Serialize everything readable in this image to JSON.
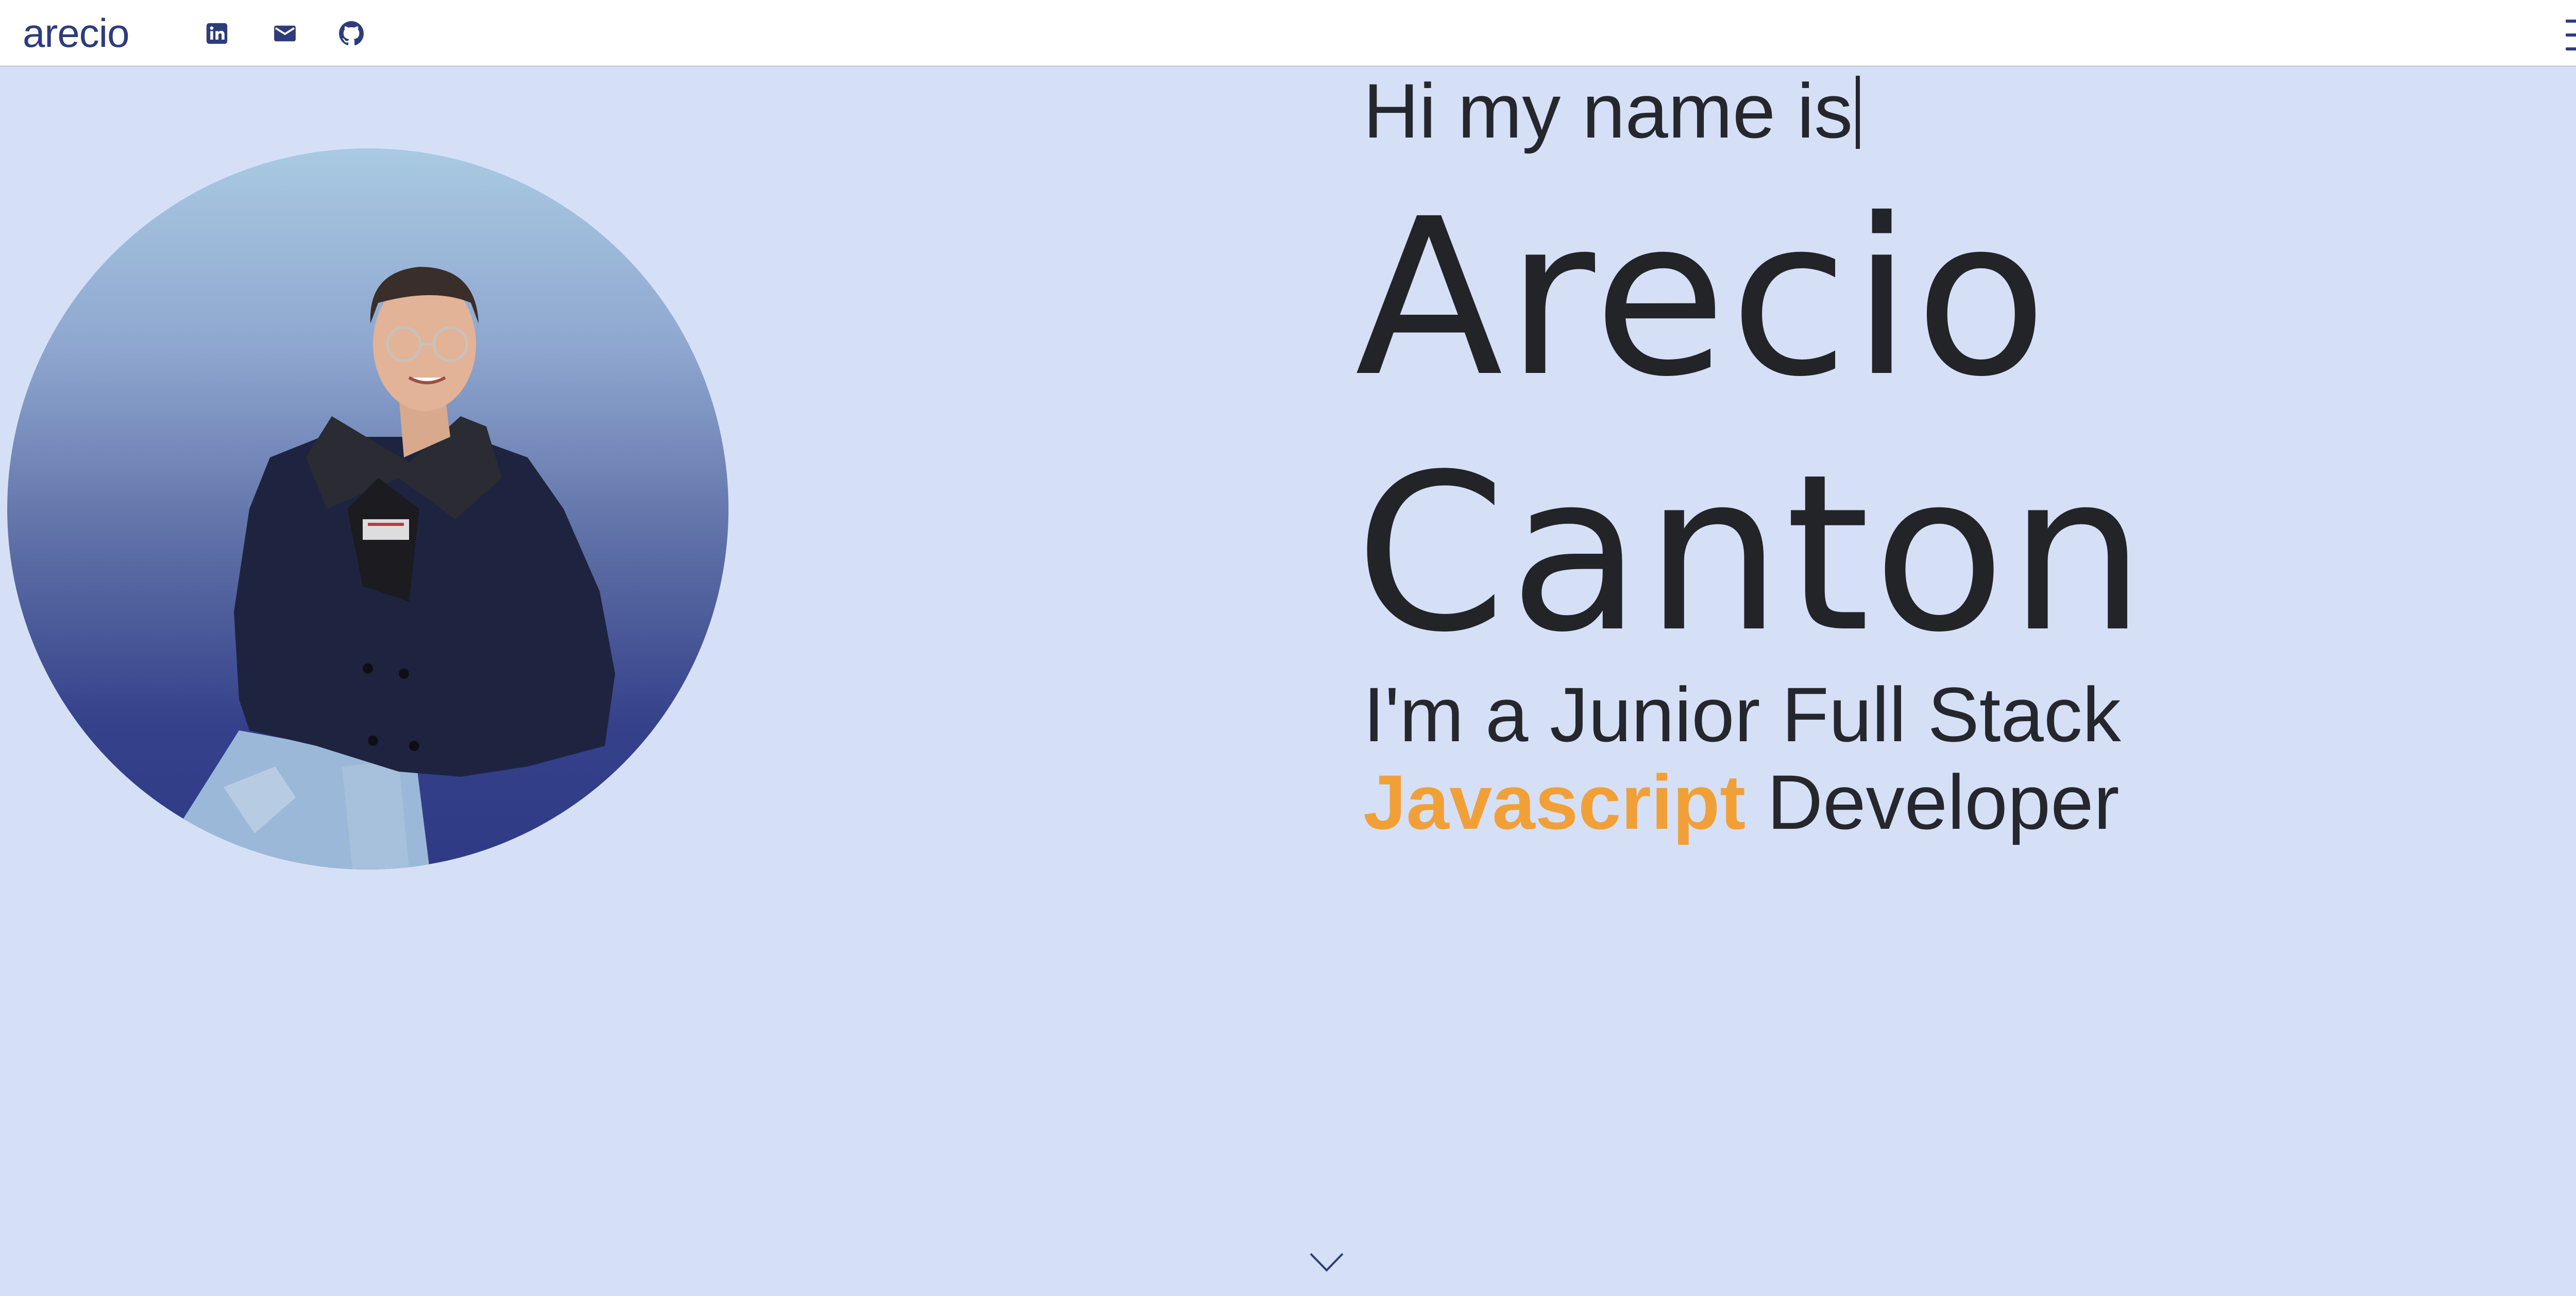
{
  "navbar": {
    "brand": "arecio",
    "social": [
      {
        "name": "linkedin-icon"
      },
      {
        "name": "mail-icon"
      },
      {
        "name": "github-icon"
      }
    ],
    "menu_icon": "hamburger-icon"
  },
  "hero": {
    "greeting": "Hi my name is",
    "first_name": "Arecio",
    "last_name": "Canton",
    "tagline_line1": "I'm a Junior Full Stack",
    "tagline_highlight": "Javascript",
    "tagline_rest": " Developer",
    "scroll_icon": "chevron-down-icon"
  },
  "colors": {
    "background": "#d5e0f7",
    "navbar": "#ffffff",
    "brand": "#2e3c7c",
    "text": "#25272d",
    "accent": "#f1a038"
  }
}
